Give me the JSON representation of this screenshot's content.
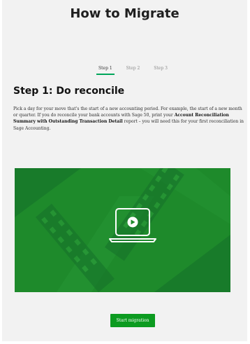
{
  "header": {
    "title": "How to Migrate"
  },
  "tabs": [
    {
      "label": "Step 1",
      "active": true
    },
    {
      "label": "Step 2",
      "active": false
    },
    {
      "label": "Step 3",
      "active": false
    }
  ],
  "step": {
    "heading": "Step 1: Do reconcile",
    "text_before": "Pick a day for your move that's the start of a new accounting period. For example, the start of a new month or quarter. If you do reconcile your bank accounts with Sage 50, print your ",
    "text_bold": "Account Reconciliation Summary with Outstanding Transaction Detail",
    "text_after": " report – you will need this for your first reconciliation in Sage Accounting."
  },
  "video": {
    "icon": "laptop-play-icon",
    "bg_color": "#1e8a2b"
  },
  "actions": {
    "start_label": "Start migration"
  },
  "colors": {
    "accent": "#0c9b20",
    "background": "#f2f2f2"
  }
}
